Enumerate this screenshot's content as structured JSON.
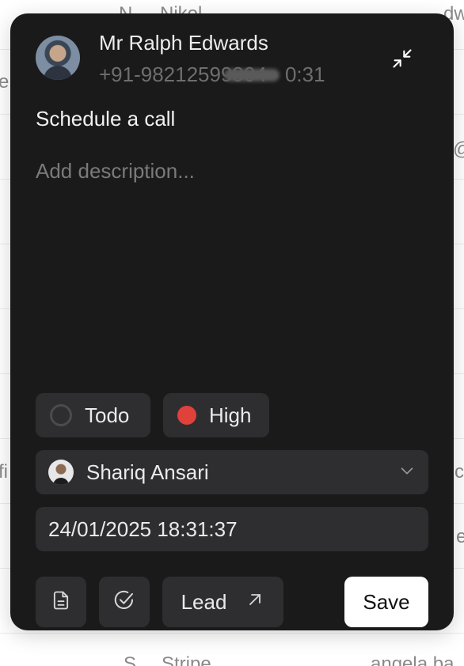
{
  "background": {
    "rows": [
      {
        "left": "N",
        "middle": "Nikol",
        "right": "dw"
      },
      {
        "left": "e",
        "middle": "",
        "right": ""
      },
      {
        "left": "",
        "middle": "",
        "right": "@"
      },
      {
        "left": "fi",
        "middle": "",
        "right": "c"
      },
      {
        "left": "",
        "middle": "",
        "right": "e"
      },
      {
        "left": "S",
        "middle": "Stripe",
        "right": "angela ba"
      }
    ]
  },
  "contact": {
    "name": "Mr Ralph Edwards",
    "phone": "+91-98212599904",
    "separator": "·",
    "duration": "0:31"
  },
  "task": {
    "title": "Schedule a call",
    "description_value": "",
    "description_placeholder": "Add description..."
  },
  "status": {
    "label": "Todo"
  },
  "priority": {
    "label": "High",
    "color": "#e0413a"
  },
  "assignee": {
    "name": "Shariq Ansari"
  },
  "due": {
    "value": "24/01/2025 18:31:37"
  },
  "actions": {
    "lead_label": "Lead",
    "save_label": "Save"
  },
  "icons": {
    "minimize": "minimize-arrows-icon",
    "document": "document-icon",
    "check": "check-circle-icon",
    "external": "arrow-up-right-icon",
    "chevron": "chevron-down-icon"
  }
}
